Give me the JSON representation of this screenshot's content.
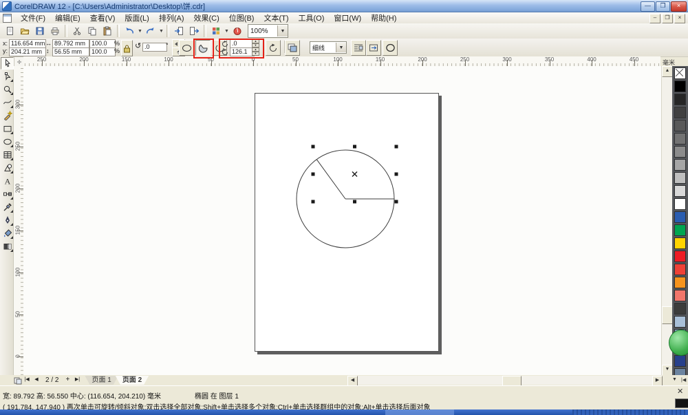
{
  "window": {
    "title": "CorelDRAW 12 - [C:\\Users\\Administrator\\Desktop\\饼.cdr]",
    "buttons": {
      "minimize": "—",
      "restore": "❐",
      "close": "×"
    }
  },
  "menu_items": [
    "文件(F)",
    "编辑(E)",
    "查看(V)",
    "版面(L)",
    "排列(A)",
    "效果(C)",
    "位图(B)",
    "文本(T)",
    "工具(O)",
    "窗口(W)",
    "帮助(H)"
  ],
  "toolbar": {
    "zoom_level": "100%",
    "icons": [
      "new",
      "open",
      "save",
      "print",
      "cut",
      "copy",
      "paste",
      "undo",
      "redo",
      "import",
      "export",
      "application-launcher",
      "corel-community"
    ]
  },
  "property_bar": {
    "position": {
      "x_label": "x:",
      "x_value": "116.654 mm",
      "y_label": "y:",
      "y_value": "204.21 mm"
    },
    "size": {
      "width": "89.792 mm",
      "height": "56.55 mm"
    },
    "scale": {
      "h": "100.0",
      "v": "100.0",
      "unit": "%"
    },
    "rotation": {
      "value": ".0",
      "unit": "°"
    },
    "pie": {
      "start_angle": ".0",
      "end_angle": "126.1"
    },
    "outline_width": "细线"
  },
  "rulers": {
    "unit": "毫米",
    "h_labels": [
      "250",
      "200",
      "150",
      "100",
      "50",
      "0",
      "50",
      "100",
      "150",
      "200",
      "250",
      "300",
      "350",
      "400",
      "450"
    ],
    "v_labels": [
      "300",
      "250",
      "200",
      "150",
      "100",
      "50",
      "0"
    ]
  },
  "toolbox": [
    {
      "name": "pick-tool",
      "flyout": false,
      "selected": true
    },
    {
      "name": "shape-tool",
      "flyout": true
    },
    {
      "name": "zoom-tool",
      "flyout": true
    },
    {
      "name": "freehand-tool",
      "flyout": true
    },
    {
      "name": "smart-drawing-tool",
      "flyout": false
    },
    {
      "name": "rectangle-tool",
      "flyout": true
    },
    {
      "name": "ellipse-tool",
      "flyout": true
    },
    {
      "name": "graph-paper-tool",
      "flyout": true
    },
    {
      "name": "basic-shapes-tool",
      "flyout": true
    },
    {
      "name": "text-tool",
      "flyout": false
    },
    {
      "name": "interactive-blend-tool",
      "flyout": true
    },
    {
      "name": "eyedropper-tool",
      "flyout": true
    },
    {
      "name": "outline-tool",
      "flyout": true
    },
    {
      "name": "fill-tool",
      "flyout": true
    },
    {
      "name": "interactive-fill-tool",
      "flyout": true
    }
  ],
  "page_bar": {
    "counter": "2 / 2",
    "tabs": [
      {
        "label": "页面 1",
        "active": false
      },
      {
        "label": "页面 2",
        "active": true
      }
    ]
  },
  "status_bar": {
    "dimensions": "宽: 89.792 高: 56.550 中心: (116.654, 204.210) 毫米",
    "object_info": "椭圆 在 图层 1",
    "hint": "( 191.784, 147.940 )  再次单击可旋转/倾斜对象;双击选择全部对象;Shift+单击选择多个对象;Ctrl+单击选择群组中的对象;Alt+单击选择后面对象"
  },
  "palette": {
    "colors": [
      "none",
      "#000000",
      "#262626",
      "#404040",
      "#595959",
      "#737373",
      "#8c8c8c",
      "#a6a6a6",
      "#bfbfbf",
      "#d9d9d9",
      "#ffffff",
      "#2a5db0",
      "#00a651",
      "#ffd400",
      "#ed1c24",
      "#ef4136",
      "#f7941d",
      "#f2766b",
      "#3c3c3b",
      "#a9c0d8",
      "#7d9cbb",
      "#3f6fb4",
      "#27408b",
      "#6c84a0",
      "#45586b",
      "#8aa4c4"
    ]
  },
  "accents": {
    "highlight_red": "#e42116",
    "titlebar_blue": "#9dbce8",
    "badge_green": "#3fae4d"
  }
}
